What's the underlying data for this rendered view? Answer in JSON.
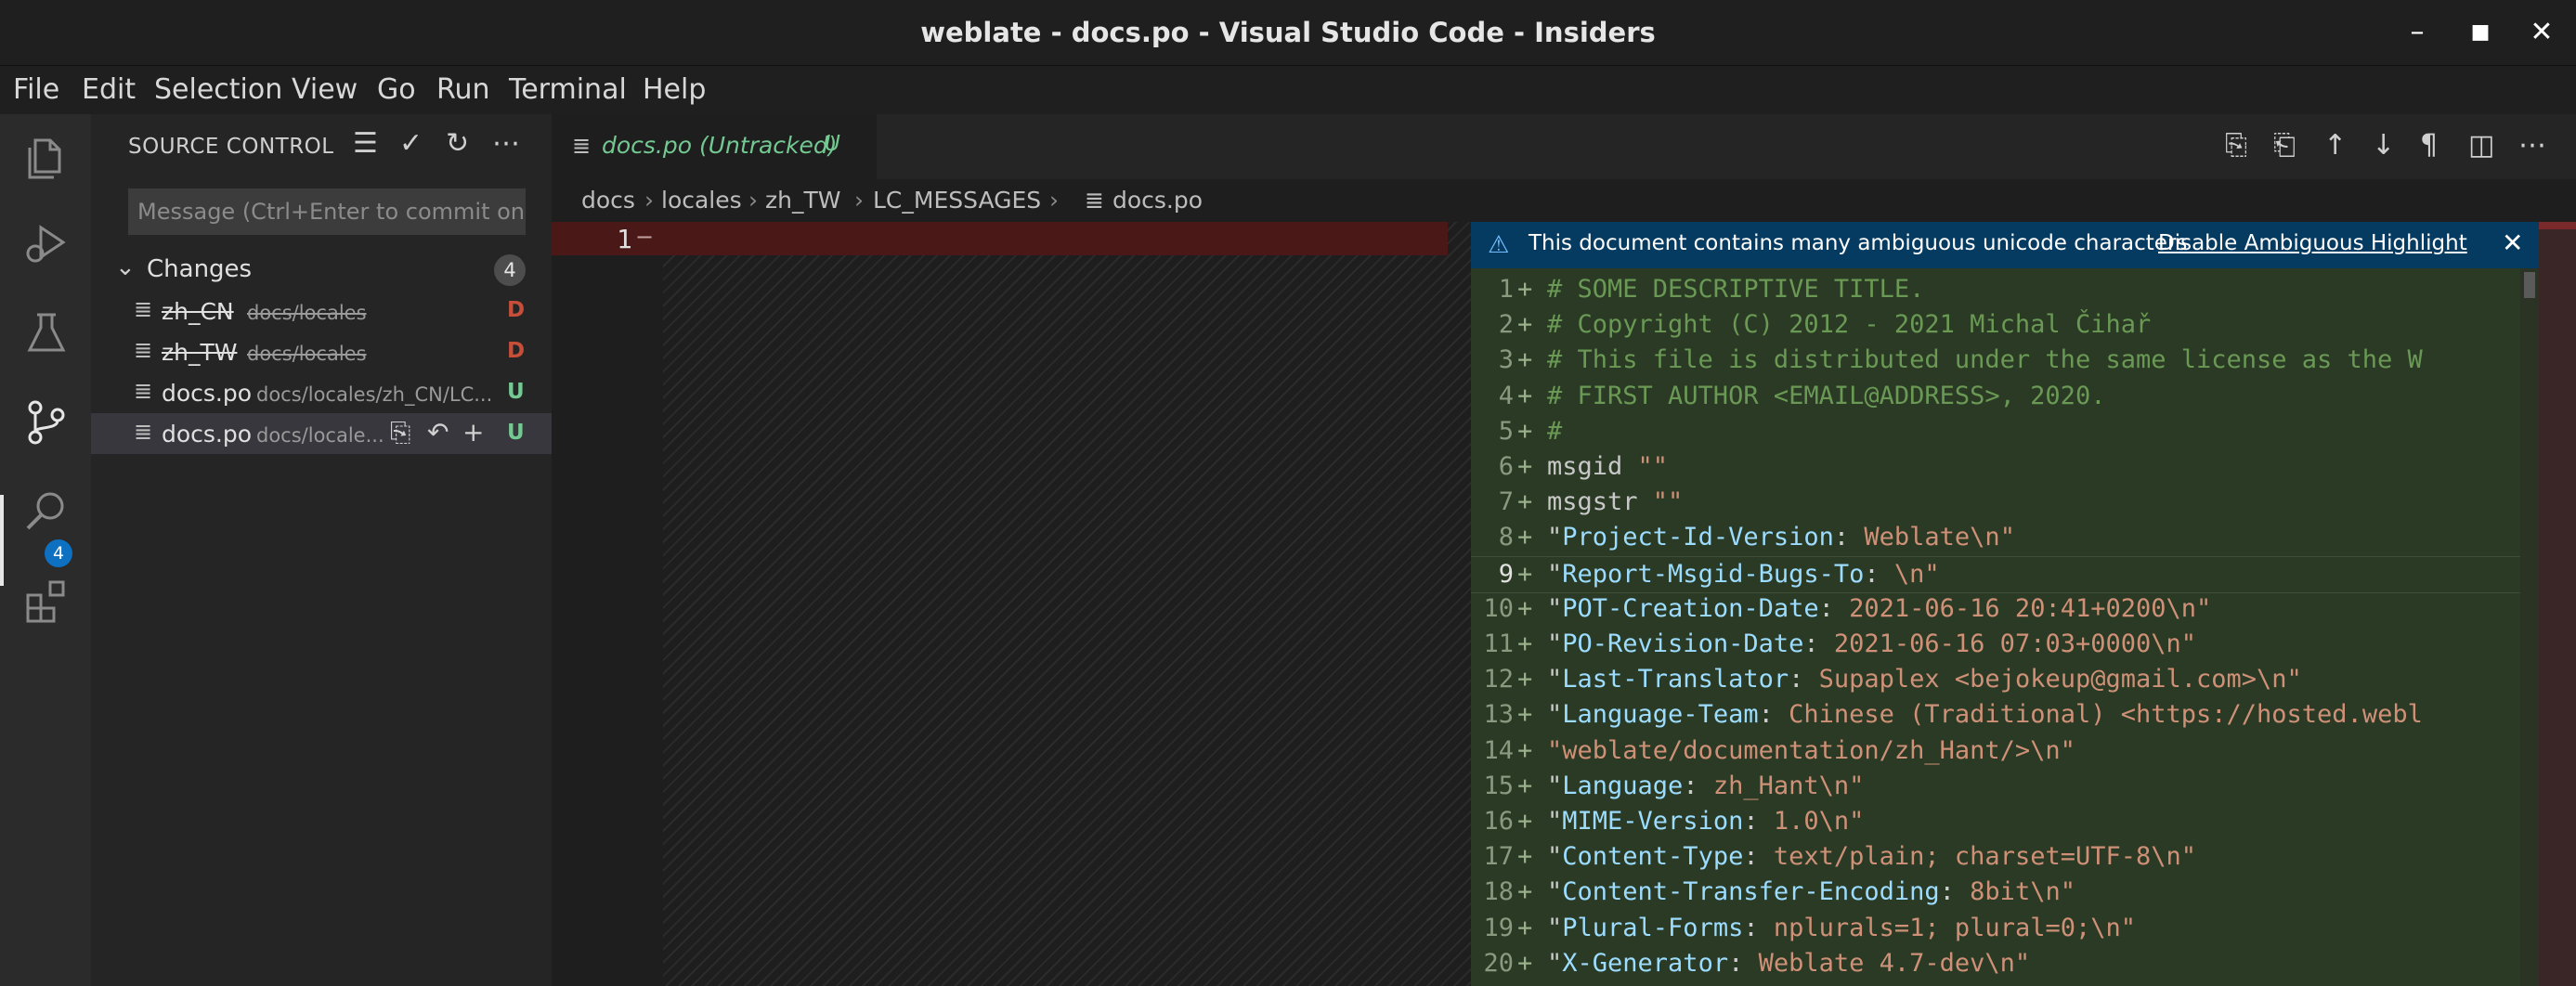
{
  "window": {
    "title": "weblate - docs.po - Visual Studio Code - Insiders"
  },
  "menu": [
    "File",
    "Edit",
    "Selection",
    "View",
    "Go",
    "Run",
    "Terminal",
    "Help"
  ],
  "activity": {
    "scm_badge": "4"
  },
  "source_control": {
    "title": "SOURCE CONTROL",
    "message_placeholder": "Message (Ctrl+Enter to commit on...",
    "changes_label": "Changes",
    "changes_count": "4",
    "files": [
      {
        "name": "zh_CN",
        "path": "docs/locales",
        "status": "D"
      },
      {
        "name": "zh_TW",
        "path": "docs/locales",
        "status": "D"
      },
      {
        "name": "docs.po",
        "path": "docs/locales/zh_CN/LC...",
        "status": "U"
      },
      {
        "name": "docs.po",
        "path": "docs/locale...",
        "status": "U"
      }
    ]
  },
  "tab": {
    "name": "docs.po (Untracked)",
    "status": "U"
  },
  "breadcrumb": [
    "docs",
    "locales",
    "zh_TW",
    "LC_MESSAGES",
    "docs.po"
  ],
  "left_editor": {
    "line": "1"
  },
  "banner": {
    "message": "This document contains many ambiguous unicode characters",
    "action": "Disable Ambiguous Highlight"
  },
  "code_lines": [
    {
      "n": "1",
      "parts": [
        [
          "cm",
          "# SOME DESCRIPTIVE TITLE."
        ]
      ]
    },
    {
      "n": "2",
      "parts": [
        [
          "cm",
          "# Copyright (C) 2012 - 2021 Michal Čihař"
        ]
      ]
    },
    {
      "n": "3",
      "parts": [
        [
          "cm",
          "# This file is distributed under the same license as the W"
        ]
      ]
    },
    {
      "n": "4",
      "parts": [
        [
          "cm",
          "# FIRST AUTHOR <EMAIL@ADDRESS>, 2020."
        ]
      ]
    },
    {
      "n": "5",
      "parts": [
        [
          "cm",
          "#"
        ]
      ]
    },
    {
      "n": "6",
      "parts": [
        [
          "kw",
          "msgid "
        ],
        [
          "st",
          "\"\""
        ]
      ]
    },
    {
      "n": "7",
      "parts": [
        [
          "kw",
          "msgstr "
        ],
        [
          "st",
          "\"\""
        ]
      ]
    },
    {
      "n": "8",
      "parts": [
        [
          "pl",
          "\""
        ],
        [
          "key",
          "Project-Id-Version"
        ],
        [
          "pl",
          ": "
        ],
        [
          "st",
          "Weblate\\n\""
        ]
      ]
    },
    {
      "n": "9",
      "parts": [
        [
          "pl",
          "\""
        ],
        [
          "key",
          "Report-Msgid-Bugs-To"
        ],
        [
          "pl",
          ": "
        ],
        [
          "st",
          "\\n\""
        ]
      ]
    },
    {
      "n": "10",
      "parts": [
        [
          "pl",
          "\""
        ],
        [
          "key",
          "POT-Creation-Date"
        ],
        [
          "pl",
          ": "
        ],
        [
          "st",
          "2021-06-16 20:41+0200\\n\""
        ]
      ]
    },
    {
      "n": "11",
      "parts": [
        [
          "pl",
          "\""
        ],
        [
          "key",
          "PO-Revision-Date"
        ],
        [
          "pl",
          ": "
        ],
        [
          "st",
          "2021-06-16 07:03+0000\\n\""
        ]
      ]
    },
    {
      "n": "12",
      "parts": [
        [
          "pl",
          "\""
        ],
        [
          "key",
          "Last-Translator"
        ],
        [
          "pl",
          ": "
        ],
        [
          "st",
          "Supaplex <bejokeup@gmail.com>\\n\""
        ]
      ]
    },
    {
      "n": "13",
      "parts": [
        [
          "pl",
          "\""
        ],
        [
          "key",
          "Language-Team"
        ],
        [
          "pl",
          ": "
        ],
        [
          "st",
          "Chinese (Traditional) <https://hosted.webl"
        ]
      ]
    },
    {
      "n": "14",
      "parts": [
        [
          "st",
          "\"weblate/documentation/zh_Hant/>\\n\""
        ]
      ]
    },
    {
      "n": "15",
      "parts": [
        [
          "pl",
          "\""
        ],
        [
          "key",
          "Language"
        ],
        [
          "pl",
          ": "
        ],
        [
          "st",
          "zh_Hant\\n\""
        ]
      ]
    },
    {
      "n": "16",
      "parts": [
        [
          "pl",
          "\""
        ],
        [
          "key",
          "MIME-Version"
        ],
        [
          "pl",
          ": "
        ],
        [
          "st",
          "1.0\\n\""
        ]
      ]
    },
    {
      "n": "17",
      "parts": [
        [
          "pl",
          "\""
        ],
        [
          "key",
          "Content-Type"
        ],
        [
          "pl",
          ": "
        ],
        [
          "st",
          "text/plain; charset=UTF-8\\n\""
        ]
      ]
    },
    {
      "n": "18",
      "parts": [
        [
          "pl",
          "\""
        ],
        [
          "key",
          "Content-Transfer-Encoding"
        ],
        [
          "pl",
          ": "
        ],
        [
          "st",
          "8bit\\n\""
        ]
      ]
    },
    {
      "n": "19",
      "parts": [
        [
          "pl",
          "\""
        ],
        [
          "key",
          "Plural-Forms"
        ],
        [
          "pl",
          ": "
        ],
        [
          "st",
          "nplurals=1; plural=0;\\n\""
        ]
      ]
    },
    {
      "n": "20",
      "parts": [
        [
          "pl",
          "\""
        ],
        [
          "key",
          "X-Generator"
        ],
        [
          "pl",
          ": "
        ],
        [
          "st",
          "Weblate 4.7-dev\\n\""
        ]
      ]
    }
  ],
  "colors": {
    "accent": "#0e70c0",
    "deleted": "#c74e39",
    "untracked": "#73c991",
    "banner": "#063b61"
  }
}
